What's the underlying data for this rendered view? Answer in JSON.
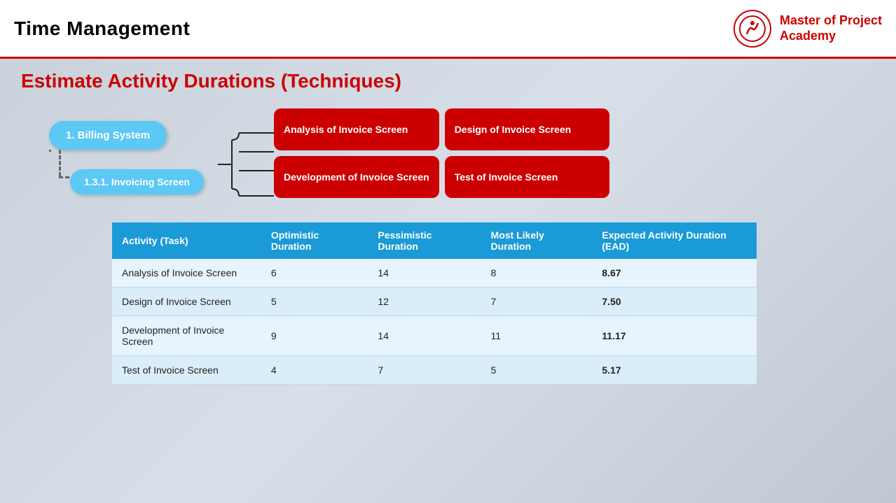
{
  "header": {
    "title": "Time Management",
    "logo": {
      "main_text": "Master of Project",
      "sub_text": "Academy"
    }
  },
  "main": {
    "section_title": "Estimate Activity Durations (Techniques)",
    "diagram": {
      "billing_node": "1. Billing System",
      "invoicing_node": "1.3.1. Invoicing Screen",
      "tasks": [
        {
          "label": "Analysis of Invoice Screen"
        },
        {
          "label": "Design of Invoice Screen"
        },
        {
          "label": "Development of Invoice Screen"
        },
        {
          "label": "Test of Invoice Screen"
        }
      ]
    },
    "table": {
      "headers": [
        {
          "key": "activity",
          "label": "Activity (Task)"
        },
        {
          "key": "optimistic",
          "label": "Optimistic Duration"
        },
        {
          "key": "pessimistic",
          "label": "Pessimistic Duration"
        },
        {
          "key": "most_likely",
          "label": "Most Likely Duration"
        },
        {
          "key": "ead",
          "label": "Expected Activity Duration (EAD)"
        }
      ],
      "rows": [
        {
          "activity": "Analysis of Invoice Screen",
          "optimistic": "6",
          "pessimistic": "14",
          "most_likely": "8",
          "ead": "8.67"
        },
        {
          "activity": "Design of Invoice Screen",
          "optimistic": "5",
          "pessimistic": "12",
          "most_likely": "7",
          "ead": "7.50"
        },
        {
          "activity": "Development of Invoice Screen",
          "optimistic": "9",
          "pessimistic": "14",
          "most_likely": "11",
          "ead": "11.17"
        },
        {
          "activity": "Test of Invoice Screen",
          "optimistic": "4",
          "pessimistic": "7",
          "most_likely": "5",
          "ead": "5.17"
        }
      ]
    }
  }
}
